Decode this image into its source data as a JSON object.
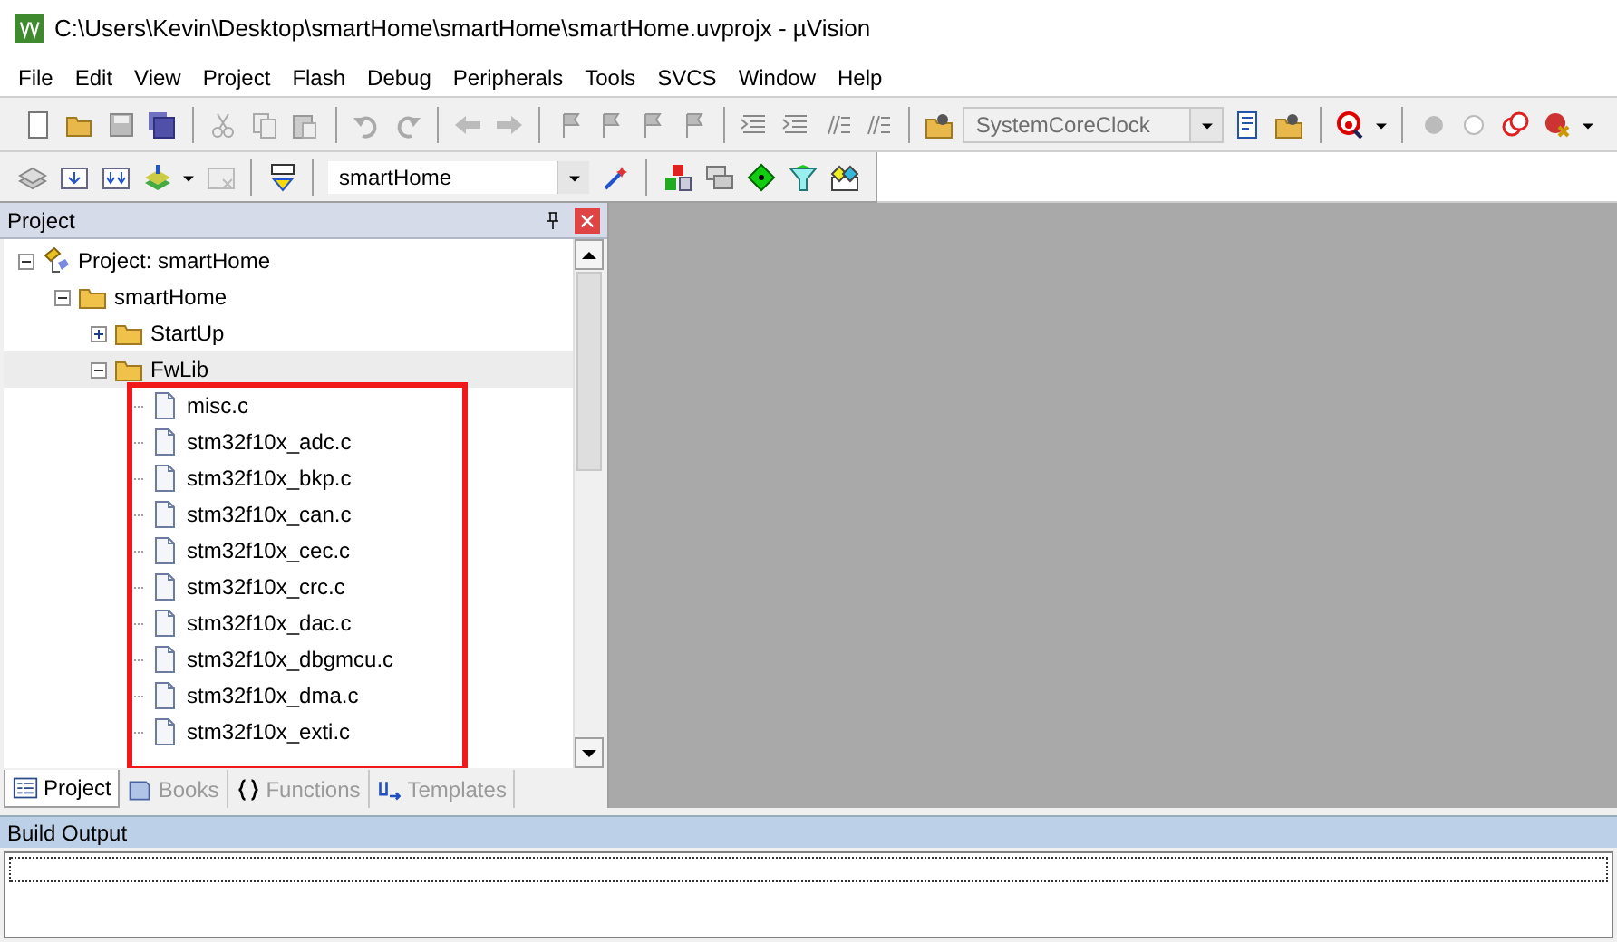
{
  "window": {
    "title": "C:\\Users\\Kevin\\Desktop\\smartHome\\smartHome\\smartHome.uvprojx - µVision"
  },
  "menu": [
    "File",
    "Edit",
    "View",
    "Project",
    "Flash",
    "Debug",
    "Peripherals",
    "Tools",
    "SVCS",
    "Window",
    "Help"
  ],
  "toolbar": {
    "find_combo": {
      "value": "SystemCoreClock",
      "disabled": true
    }
  },
  "build_toolbar": {
    "target_combo": {
      "value": "smartHome"
    }
  },
  "project_panel": {
    "title": "Project",
    "tree": [
      {
        "label": "Project: smartHome",
        "kind": "project",
        "expanded": true,
        "children": [
          {
            "label": "smartHome",
            "kind": "target",
            "expanded": true,
            "children": [
              {
                "label": "StartUp",
                "kind": "group",
                "expanded": false
              },
              {
                "label": "FwLib",
                "kind": "group",
                "expanded": true,
                "selected": true,
                "children": [
                  {
                    "label": "misc.c",
                    "kind": "file"
                  },
                  {
                    "label": "stm32f10x_adc.c",
                    "kind": "file"
                  },
                  {
                    "label": "stm32f10x_bkp.c",
                    "kind": "file"
                  },
                  {
                    "label": "stm32f10x_can.c",
                    "kind": "file"
                  },
                  {
                    "label": "stm32f10x_cec.c",
                    "kind": "file"
                  },
                  {
                    "label": "stm32f10x_crc.c",
                    "kind": "file"
                  },
                  {
                    "label": "stm32f10x_dac.c",
                    "kind": "file"
                  },
                  {
                    "label": "stm32f10x_dbgmcu.c",
                    "kind": "file"
                  },
                  {
                    "label": "stm32f10x_dma.c",
                    "kind": "file"
                  },
                  {
                    "label": "stm32f10x_exti.c",
                    "kind": "file"
                  }
                ]
              }
            ]
          }
        ]
      }
    ],
    "annotation": {
      "kind": "red-frame"
    },
    "tabs": [
      {
        "label": "Project",
        "selected": true
      },
      {
        "label": "Books",
        "selected": false
      },
      {
        "label": "Functions",
        "selected": false
      },
      {
        "label": "Templates",
        "selected": false
      }
    ]
  },
  "build_output": {
    "title": "Build Output"
  }
}
